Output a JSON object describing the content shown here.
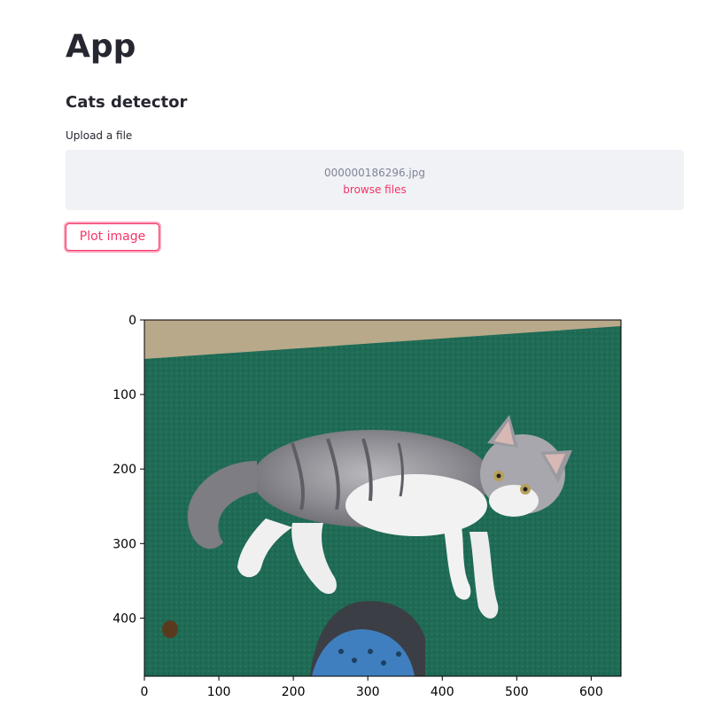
{
  "app": {
    "title": "App",
    "subtitle": "Cats detector"
  },
  "uploader": {
    "label": "Upload a file",
    "filename": "000000186296.jpg",
    "browse_label": "browse files"
  },
  "button": {
    "label": "Plot image"
  },
  "colors": {
    "accent": "#f63366",
    "dropzone_bg": "#f0f2f6",
    "carpet": "#1f6b55"
  },
  "chart_data": {
    "type": "image",
    "x_ticks": [
      "0",
      "100",
      "200",
      "300",
      "400",
      "500",
      "600"
    ],
    "y_ticks": [
      "0",
      "100",
      "200",
      "300",
      "400"
    ],
    "xlim": [
      0,
      640
    ],
    "ylim": [
      0,
      478
    ],
    "image_subject": "kitten"
  }
}
